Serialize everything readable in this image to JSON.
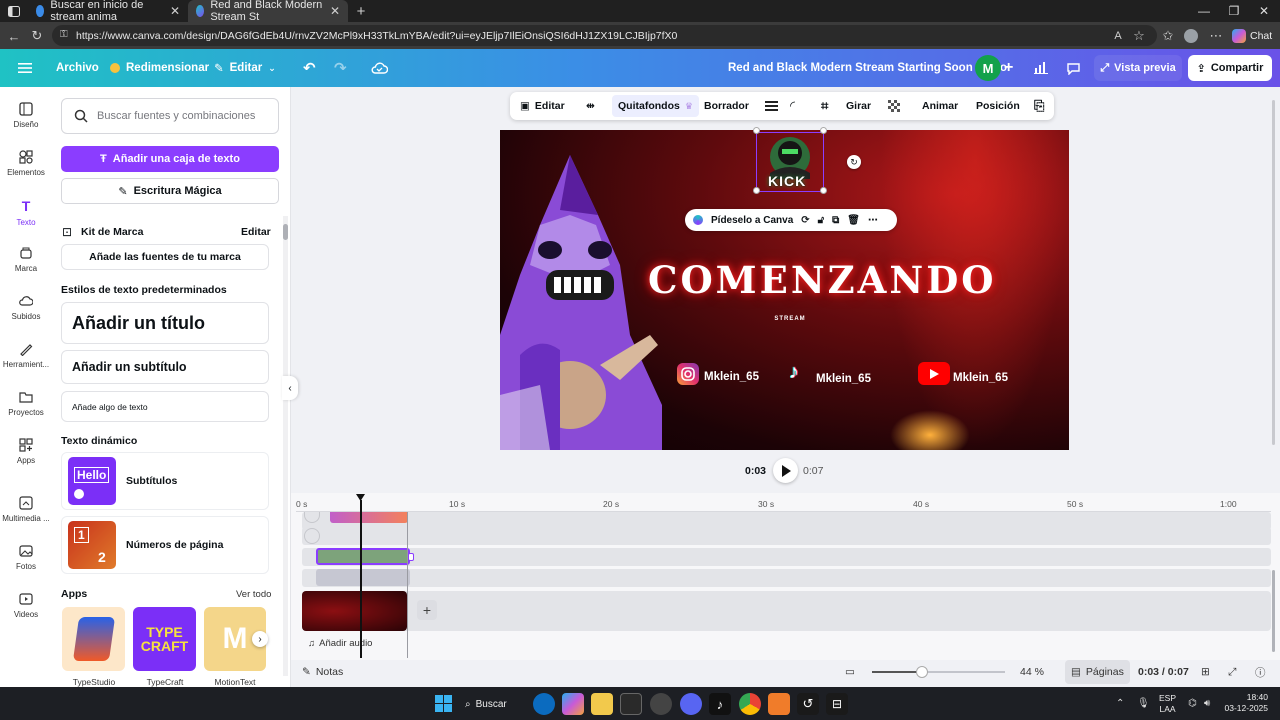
{
  "browser": {
    "tabs": [
      {
        "label": "Buscar en inicio de stream anima",
        "active": false
      },
      {
        "label": "Red and Black Modern Stream St",
        "active": true
      }
    ],
    "new_tab": "+",
    "url": "https://www.canva.com/design/DAG6fGdEb4U/rnvZV2McPl9xH33TkLmYBA/edit?ui=eyJEljp7IlEiOnsiQSI6dHJ1ZX19LCJBIjp7fX0",
    "chat_label": "Chat"
  },
  "topbar": {
    "menu": "Archivo",
    "resize": "Redimensionar",
    "edit": "Editar",
    "design_title": "Red and Black Modern Stream Starting Soon Video",
    "avatar_initial": "M",
    "preview": "Vista previa",
    "share": "Compartir"
  },
  "rail": [
    {
      "label": "Diseño",
      "icon": "layout-icon"
    },
    {
      "label": "Elementos",
      "icon": "elements-icon"
    },
    {
      "label": "Texto",
      "icon": "text-icon"
    },
    {
      "label": "Marca",
      "icon": "brand-icon"
    },
    {
      "label": "Subidos",
      "icon": "upload-icon"
    },
    {
      "label": "Herramient...",
      "icon": "draw-icon"
    },
    {
      "label": "Proyectos",
      "icon": "folder-icon"
    },
    {
      "label": "Apps",
      "icon": "apps-icon"
    },
    {
      "label": "Multimedia ...",
      "icon": "media-icon"
    },
    {
      "label": "Fotos",
      "icon": "photo-icon"
    },
    {
      "label": "Videos",
      "icon": "video-icon"
    }
  ],
  "panel": {
    "search_placeholder": "Buscar fuentes y combinaciones",
    "add_textbox": "Añadir una caja de texto",
    "magic_write": "Escritura Mágica",
    "brand_kit": "Kit de Marca",
    "brand_edit": "Editar",
    "brand_fonts": "Añade las fuentes de tu marca",
    "default_styles": "Estilos de texto predeterminados",
    "add_title": "Añadir un título",
    "add_subtitle": "Añadir un subtítulo",
    "add_body": "Añade algo de texto",
    "dynamic_text": "Texto dinámico",
    "subtitles": "Subtítulos",
    "hello": "Hello",
    "page_numbers": "Números de página",
    "pn_1": "1",
    "pn_2": "2",
    "apps_title": "Apps",
    "apps_all": "Ver todo",
    "apps": [
      "TypeStudio",
      "TypeCraft",
      "MotionText"
    ]
  },
  "context_toolbar": {
    "edit": "Editar",
    "bg_remover": "Quitafondos",
    "eraser": "Borrador",
    "rotate": "Girar",
    "animate": "Animar",
    "position": "Posición"
  },
  "canvas": {
    "ask_canva": "Pídeselo a Canva",
    "headline": "COMENZANDO",
    "sub": "STREAM",
    "logo_text": "KICK",
    "socials": [
      {
        "platform": "instagram",
        "handle": "Mklein_65"
      },
      {
        "platform": "tiktok",
        "handle": "Mklein_65"
      },
      {
        "platform": "youtube",
        "handle": "Mklein_65"
      }
    ]
  },
  "playback": {
    "current": "0:03",
    "total": "0:07"
  },
  "timeline": {
    "ticks": [
      "0 s",
      "10 s",
      "20 s",
      "30 s",
      "40 s",
      "50 s",
      "1:00"
    ],
    "add_audio": "Añadir audio",
    "add": "+"
  },
  "bottom": {
    "notes": "Notas",
    "zoom": "44 %",
    "zoom_level": 0.44,
    "pages": "Páginas",
    "page_time": "0:03 / 0:07"
  },
  "taskbar": {
    "search": "Buscar",
    "lang_top": "ESP",
    "lang_bottom": "LAA",
    "time": "18:40",
    "date": "03-12-2025"
  },
  "colors": {
    "accent_purple": "#8b3dff",
    "gradient_start": "#1fc2c4",
    "gradient_end": "#6a52e8",
    "canvas_red": "#b3181a"
  }
}
